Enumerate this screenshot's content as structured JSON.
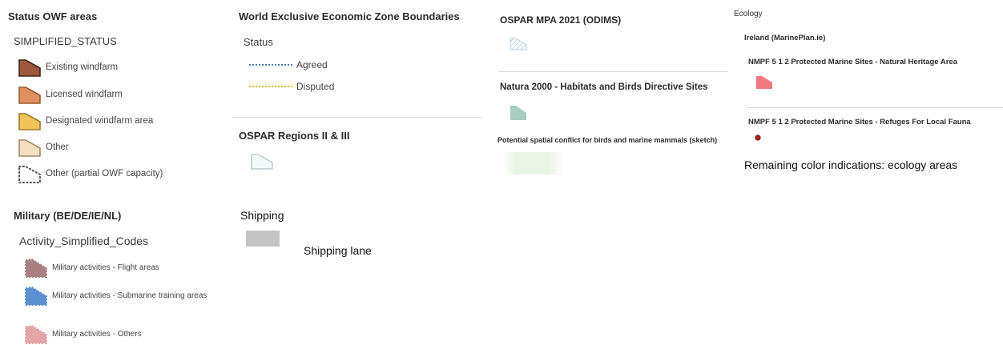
{
  "col1": {
    "status_title": "Status OWF areas",
    "status_field": "SIMPLIFIED_STATUS",
    "status_items": [
      {
        "label": "Existing windfarm",
        "fill": "#a0583b",
        "stroke": "#3d2418"
      },
      {
        "label": "Licensed windfarm",
        "fill": "#e09060",
        "stroke": "#9a5a30"
      },
      {
        "label": "Designated windfarm area",
        "fill": "#f2c35a",
        "stroke": "#9a7a2a"
      },
      {
        "label": "Other",
        "fill": "#f4dfc0",
        "stroke": "#a08a68"
      },
      {
        "label": "Other (partial OWF capacity)",
        "fill": "#ffffff",
        "stroke": "#555555"
      }
    ],
    "military_title": "Military (BE/DE/IE/NL)",
    "military_field": "Activity_Simplified_Codes",
    "military_items": [
      {
        "label": "Military activities - Flight areas",
        "fill": "#a98080"
      },
      {
        "label": "Military activities - Submarine training areas",
        "fill": "#5b8fcf"
      },
      {
        "label": "Military activities - Others",
        "fill": "#e3a6a6"
      }
    ]
  },
  "col2": {
    "eez_title": "World Exclusive Economic Zone Boundaries",
    "eez_field": "Status",
    "eez_items": [
      {
        "label": "Agreed",
        "color": "#4a78b8"
      },
      {
        "label": "Disputed",
        "color": "#e6b422"
      }
    ],
    "ospar_title": "OSPAR Regions II & III",
    "shipping_title": "Shipping",
    "shipping_lane_label": "Shipping lane",
    "shipping_color": "#c4c4c4"
  },
  "col3": {
    "mpa_title": "OSPAR MPA 2021 (ODIMS)",
    "natura_title": "Natura 2000 - Habitats and Birds Directive Sites",
    "natura_color": "#a8cbbf",
    "conflict_title": "Potential spatial conflict for birds and marine mammals (sketch)",
    "conflict_color": "#e8f5e4"
  },
  "col4": {
    "ecology_title": "Ecology",
    "ireland_title": "Ireland (MarinePlan.ie)",
    "nha_label": "NMPF 5 1 2 Protected Marine Sites - Natural Heritage Area",
    "nha_color": "#f07a80",
    "refuges_label": "NMPF 5 1 2 Protected Marine Sites - Refuges For Local Fauna",
    "refuges_color": "#b31f14",
    "remaining_note": "Remaining color indications: ecology areas"
  }
}
